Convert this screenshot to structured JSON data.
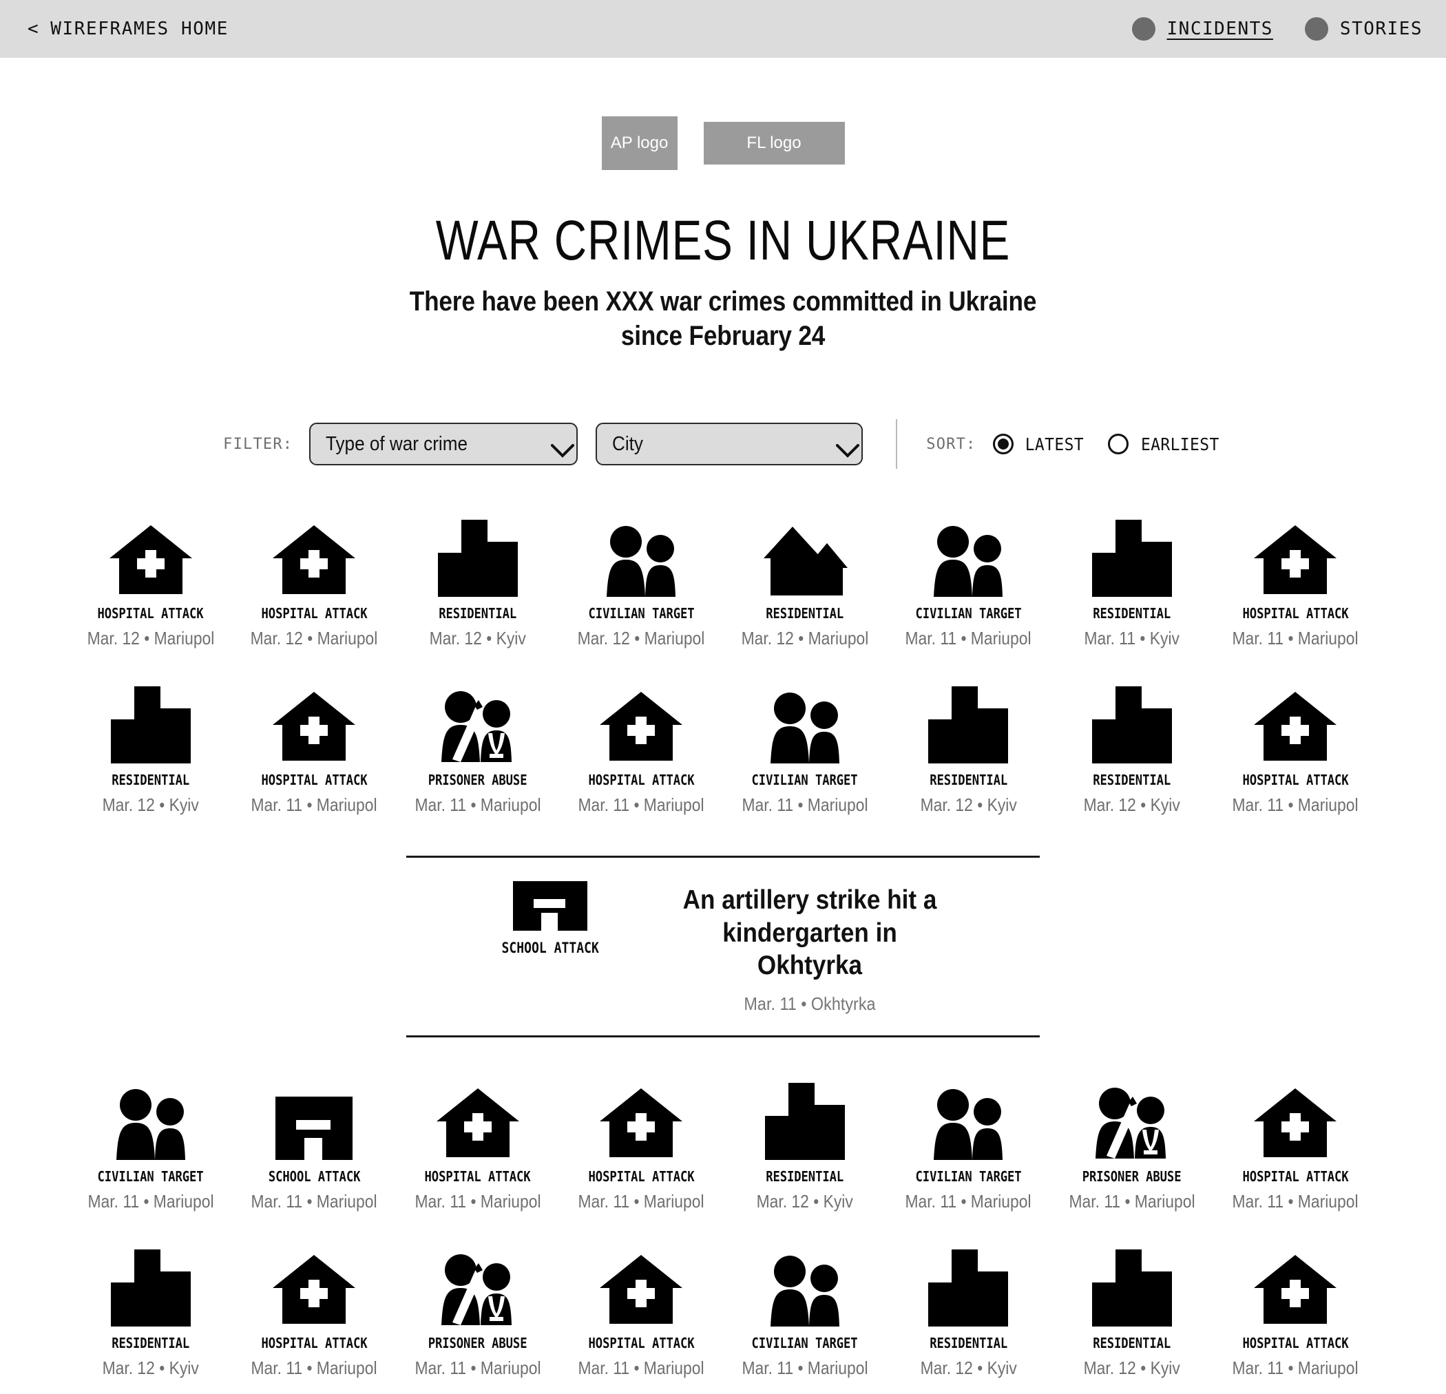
{
  "header": {
    "home_label": "WIREFRAMES HOME",
    "back_chevron": "<",
    "nav": [
      {
        "label": "INCIDENTS",
        "active": true
      },
      {
        "label": "STORIES",
        "active": false
      }
    ]
  },
  "logos": [
    {
      "label": "AP logo",
      "shape": "square"
    },
    {
      "label": "FL logo",
      "shape": "wide"
    }
  ],
  "hero": {
    "title": "WAR CRIMES IN UKRAINE",
    "subtitle_line1": "There have been XXX war crimes committed in Ukraine",
    "subtitle_line2": "since February 24"
  },
  "controls": {
    "filter_label": "FILTER:",
    "filters": [
      {
        "name": "type-of-war-crime",
        "value": "Type of war crime",
        "icon": "chevron-down-icon"
      },
      {
        "name": "city",
        "value": "City",
        "icon": "chevron-down-icon"
      }
    ],
    "sort_label": "SORT:",
    "sort_options": [
      {
        "label": "LATEST",
        "selected": true
      },
      {
        "label": "EARLIEST",
        "selected": false
      }
    ]
  },
  "featured_story": {
    "icon": "school-attack-icon",
    "type": "SCHOOL ATTACK",
    "headline": "An artillery strike hit a kindergarten in Okhtyrka",
    "meta": "Mar. 11 • Okhtyrka"
  },
  "grid_block_1": [
    [
      {
        "icon": "hospital-attack-icon",
        "type": "HOSPITAL ATTACK",
        "meta": "Mar. 12 • Mariupol"
      },
      {
        "icon": "hospital-attack-icon",
        "type": "HOSPITAL ATTACK",
        "meta": "Mar. 12 • Mariupol"
      },
      {
        "icon": "residential-block-icon",
        "type": "RESIDENTIAL",
        "meta": "Mar. 12 • Kyiv"
      },
      {
        "icon": "civilian-target-icon",
        "type": "CIVILIAN TARGET",
        "meta": "Mar. 12 • Mariupol"
      },
      {
        "icon": "residential-houses-icon",
        "type": "RESIDENTIAL",
        "meta": "Mar. 12 • Mariupol"
      },
      {
        "icon": "civilian-target-icon",
        "type": "CIVILIAN TARGET",
        "meta": "Mar. 11 • Mariupol"
      },
      {
        "icon": "residential-block-icon",
        "type": "RESIDENTIAL",
        "meta": "Mar. 11 • Kyiv"
      },
      {
        "icon": "hospital-attack-icon",
        "type": "HOSPITAL ATTACK",
        "meta": "Mar. 11 • Mariupol"
      }
    ],
    [
      {
        "icon": "residential-block-icon",
        "type": "RESIDENTIAL",
        "meta": "Mar. 12 • Kyiv"
      },
      {
        "icon": "hospital-attack-icon",
        "type": "HOSPITAL ATTACK",
        "meta": "Mar. 11 • Mariupol"
      },
      {
        "icon": "prisoner-abuse-icon",
        "type": "PRISONER ABUSE",
        "meta": "Mar. 11 • Mariupol"
      },
      {
        "icon": "hospital-attack-icon",
        "type": "HOSPITAL ATTACK",
        "meta": "Mar. 11 • Mariupol"
      },
      {
        "icon": "civilian-target-icon",
        "type": "CIVILIAN TARGET",
        "meta": "Mar. 11 • Mariupol"
      },
      {
        "icon": "residential-block-icon",
        "type": "RESIDENTIAL",
        "meta": "Mar. 12 • Kyiv"
      },
      {
        "icon": "residential-block-icon",
        "type": "RESIDENTIAL",
        "meta": "Mar. 12 • Kyiv"
      },
      {
        "icon": "hospital-attack-icon",
        "type": "HOSPITAL ATTACK",
        "meta": "Mar. 11 • Mariupol"
      }
    ]
  ],
  "grid_block_2": [
    [
      {
        "icon": "civilian-target-icon",
        "type": "CIVILIAN TARGET",
        "meta": "Mar. 11 • Mariupol"
      },
      {
        "icon": "school-attack-icon",
        "type": "SCHOOL ATTACK",
        "meta": "Mar. 11 • Mariupol"
      },
      {
        "icon": "hospital-attack-icon",
        "type": "HOSPITAL ATTACK",
        "meta": "Mar. 11 • Mariupol"
      },
      {
        "icon": "hospital-attack-icon",
        "type": "HOSPITAL ATTACK",
        "meta": "Mar. 11 • Mariupol"
      },
      {
        "icon": "residential-block-icon",
        "type": "RESIDENTIAL",
        "meta": "Mar. 12 • Kyiv"
      },
      {
        "icon": "civilian-target-icon",
        "type": "CIVILIAN TARGET",
        "meta": "Mar. 11 • Mariupol"
      },
      {
        "icon": "prisoner-abuse-icon",
        "type": "PRISONER ABUSE",
        "meta": "Mar. 11 • Mariupol"
      },
      {
        "icon": "hospital-attack-icon",
        "type": "HOSPITAL ATTACK",
        "meta": "Mar. 11 • Mariupol"
      }
    ],
    [
      {
        "icon": "residential-block-icon",
        "type": "RESIDENTIAL",
        "meta": "Mar. 12 • Kyiv"
      },
      {
        "icon": "hospital-attack-icon",
        "type": "HOSPITAL ATTACK",
        "meta": "Mar. 11 • Mariupol"
      },
      {
        "icon": "prisoner-abuse-icon",
        "type": "PRISONER ABUSE",
        "meta": "Mar. 11 • Mariupol"
      },
      {
        "icon": "hospital-attack-icon",
        "type": "HOSPITAL ATTACK",
        "meta": "Mar. 11 • Mariupol"
      },
      {
        "icon": "civilian-target-icon",
        "type": "CIVILIAN TARGET",
        "meta": "Mar. 11 • Mariupol"
      },
      {
        "icon": "residential-block-icon",
        "type": "RESIDENTIAL",
        "meta": "Mar. 12 • Kyiv"
      },
      {
        "icon": "residential-block-icon",
        "type": "RESIDENTIAL",
        "meta": "Mar. 12 • Kyiv"
      },
      {
        "icon": "hospital-attack-icon",
        "type": "HOSPITAL ATTACK",
        "meta": "Mar. 11 • Mariupol"
      }
    ]
  ],
  "colors": {
    "topbar_bg": "#dcdcdc",
    "logo_bg": "#9b9b9b",
    "nav_dot": "#6b6b6b",
    "icon_fill": "#000000",
    "meta_text": "#6f6f6f",
    "select_bg": "#dcdcdc"
  }
}
